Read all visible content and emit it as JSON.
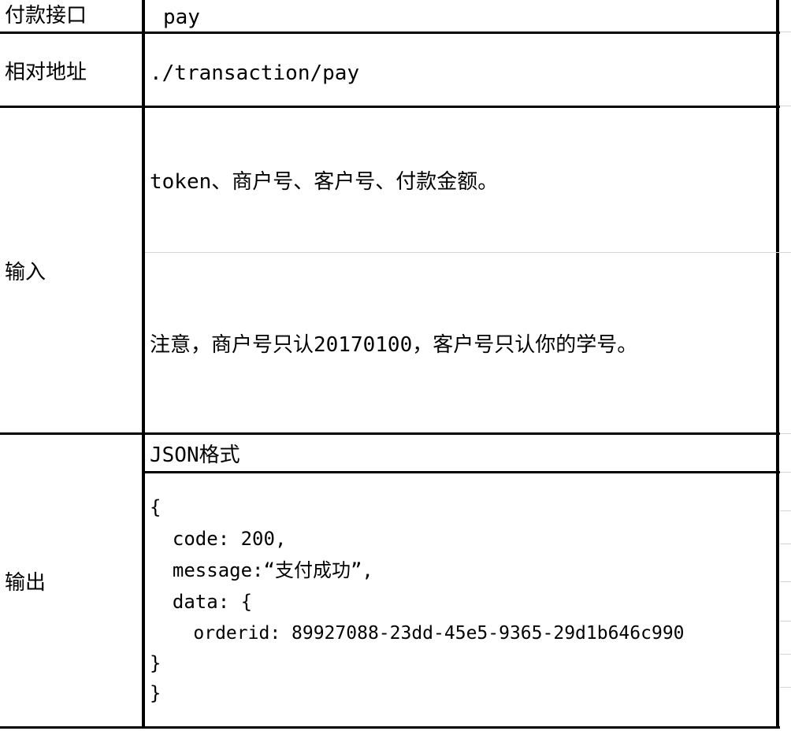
{
  "rows": {
    "payment_interface": {
      "label": "付款接口",
      "value": "pay"
    },
    "relative_address": {
      "label": "相对地址",
      "value": "./transaction/pay"
    },
    "input": {
      "label": "输入",
      "params": "token、商户号、客户号、付款金额。",
      "note": "注意，商户号只认20170100，客户号只认你的学号。"
    },
    "output": {
      "label": "输出",
      "format": "JSON格式",
      "code_lines": [
        "{",
        "  code: 200,",
        "  message:“支付成功”,",
        "  data: {",
        "    orderid: 89927088-23dd-45e5-9365-29d1b646c990",
        "}",
        "}"
      ]
    }
  }
}
